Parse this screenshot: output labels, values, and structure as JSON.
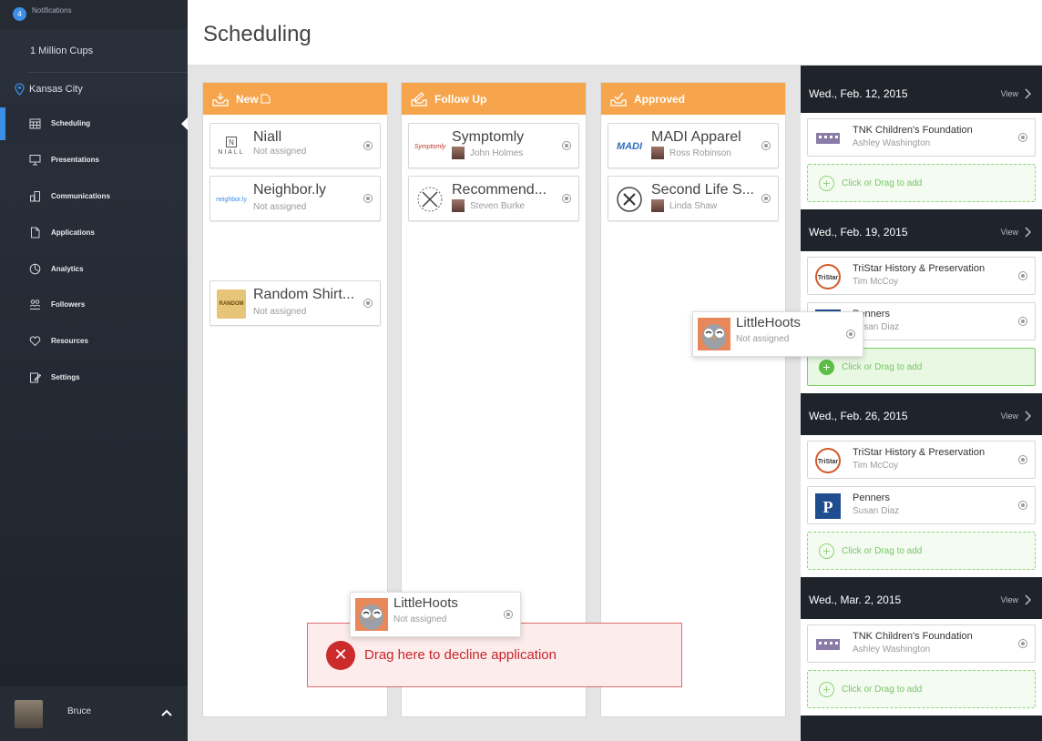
{
  "sidebar": {
    "notifications": {
      "count": "4",
      "label": "Notifications"
    },
    "org": "1 Million Cups",
    "city": "Kansas City",
    "items": [
      {
        "label": "Scheduling",
        "icon": "calendar-icon",
        "active": true
      },
      {
        "label": "Presentations",
        "icon": "presentation-icon"
      },
      {
        "label": "Communications",
        "icon": "communications-icon"
      },
      {
        "label": "Applications",
        "icon": "document-icon"
      },
      {
        "label": "Analytics",
        "icon": "analytics-icon"
      },
      {
        "label": "Followers",
        "icon": "followers-icon"
      },
      {
        "label": "Resources",
        "icon": "resources-icon"
      },
      {
        "label": "Settings",
        "icon": "settings-icon"
      }
    ],
    "user": {
      "name": "Bruce"
    }
  },
  "header": {
    "title": "Scheduling"
  },
  "columns": [
    {
      "title": "New",
      "cards": [
        {
          "name": "Niall",
          "sub": "Not assigned",
          "logo_text": "NIALL"
        },
        {
          "name": "Neighbor.ly",
          "sub": "Not assigned",
          "logo_text": "neighbor.ly"
        },
        {
          "name": "Random Shirt...",
          "sub": "Not assigned",
          "logo_text": "RANDOM"
        }
      ]
    },
    {
      "title": "Follow Up",
      "cards": [
        {
          "name": "Symptomly",
          "sub": "John Holmes",
          "logo_text": "Symptomly"
        },
        {
          "name": "Recommend...",
          "sub": "Steven Burke",
          "logo_text": ""
        }
      ]
    },
    {
      "title": "Approved",
      "cards": [
        {
          "name": "MADI Apparel",
          "sub": "Ross Robinson",
          "logo_text": "MADI"
        },
        {
          "name": "Second Life S...",
          "sub": "Linda Shaw",
          "logo_text": ""
        }
      ]
    }
  ],
  "dragging": [
    {
      "name": "LittleHoots",
      "sub": "Not assigned"
    },
    {
      "name": "LittleHoots",
      "sub": "Not assigned"
    }
  ],
  "decline": {
    "text": "Drag here to decline application",
    "icon": "close-icon"
  },
  "schedule": [
    {
      "date": "Wed., Feb. 12, 2015",
      "view": "View",
      "slots": [
        {
          "name": "TNK Children's Foundation",
          "person": "Ashley Washington"
        }
      ],
      "add": "Click or Drag to add"
    },
    {
      "date": "Wed., Feb. 19, 2015",
      "view": "View",
      "slots": [
        {
          "name": "TriStar History & Preservation",
          "person": "Tim McCoy"
        },
        {
          "name": "Penners",
          "person": "Susan Diaz"
        }
      ],
      "add": "Click or Drag to add"
    },
    {
      "date": "Wed., Feb. 26, 2015",
      "view": "View",
      "slots": [
        {
          "name": "TriStar History & Preservation",
          "person": "Tim McCoy"
        },
        {
          "name": "Penners",
          "person": "Susan Diaz"
        }
      ],
      "add": "Click or Drag to add"
    },
    {
      "date": "Wed., Mar. 2, 2015",
      "view": "View",
      "slots": [
        {
          "name": "TNK Children's Foundation",
          "person": "Ashley Washington"
        }
      ],
      "add": "Click or Drag to add"
    }
  ],
  "colors": {
    "accent": "#3c8ee6",
    "column_header": "#f6a54d",
    "add_green": "#5bbf45",
    "decline_red": "#cc2b2b"
  }
}
